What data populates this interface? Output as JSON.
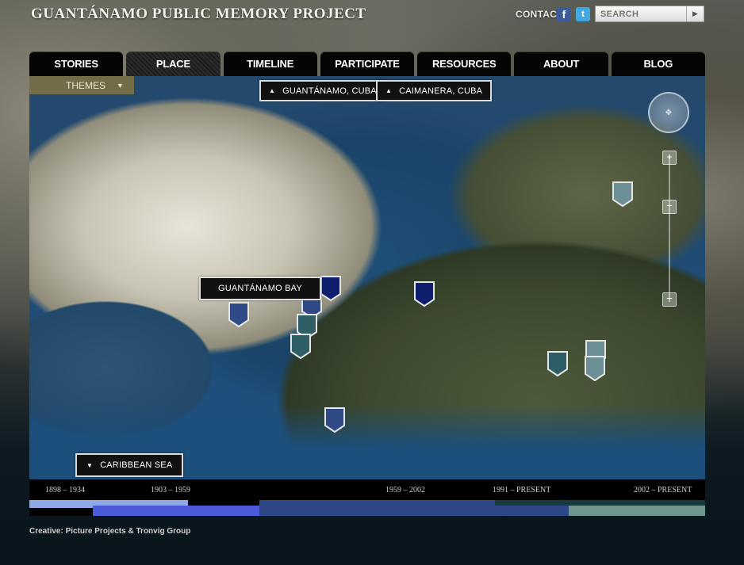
{
  "site_title": "GUANTÁNAMO PUBLIC MEMORY PROJECT",
  "header": {
    "contact": "CONTACT",
    "facebook_glyph": "f",
    "twitter_glyph": "t",
    "search_placeholder": "SEARCH",
    "search_icon": "play-arrow-icon"
  },
  "nav": {
    "items": [
      {
        "label": "STORIES"
      },
      {
        "label": "PLACE",
        "active": true
      },
      {
        "label": "TIMELINE"
      },
      {
        "label": "PARTICIPATE"
      },
      {
        "label": "RESOURCES"
      },
      {
        "label": "ABOUT"
      },
      {
        "label": "BLOG"
      }
    ]
  },
  "map": {
    "themes_label": "THEMES",
    "labels": {
      "guantanamo_cuba": "GUANTÁNAMO, CUBA",
      "caimanera_cuba": "CAIMANERA, CUBA",
      "guantanamo_bay": "GUANTÁNAMO BAY",
      "caribbean_sea": "CARIBBEAN SEA"
    },
    "colors": {
      "marker_dark": "#0f1f6e",
      "marker_blue": "#2f4a86",
      "marker_teal": "#2f5f66",
      "marker_gray": "#6b8f94"
    }
  },
  "timeline": {
    "periods": [
      "1898 – 1934",
      "1903 – 1959",
      "1959 – 2002",
      "1991 – PRESENT",
      "2002 – PRESENT"
    ],
    "colors": [
      "#8fa8e8",
      "#4b5bd9",
      "#2e4787",
      "#173a3e",
      "#6f958f"
    ]
  },
  "footer": {
    "credit": "Creative: Picture Projects & Tronvig Group"
  }
}
